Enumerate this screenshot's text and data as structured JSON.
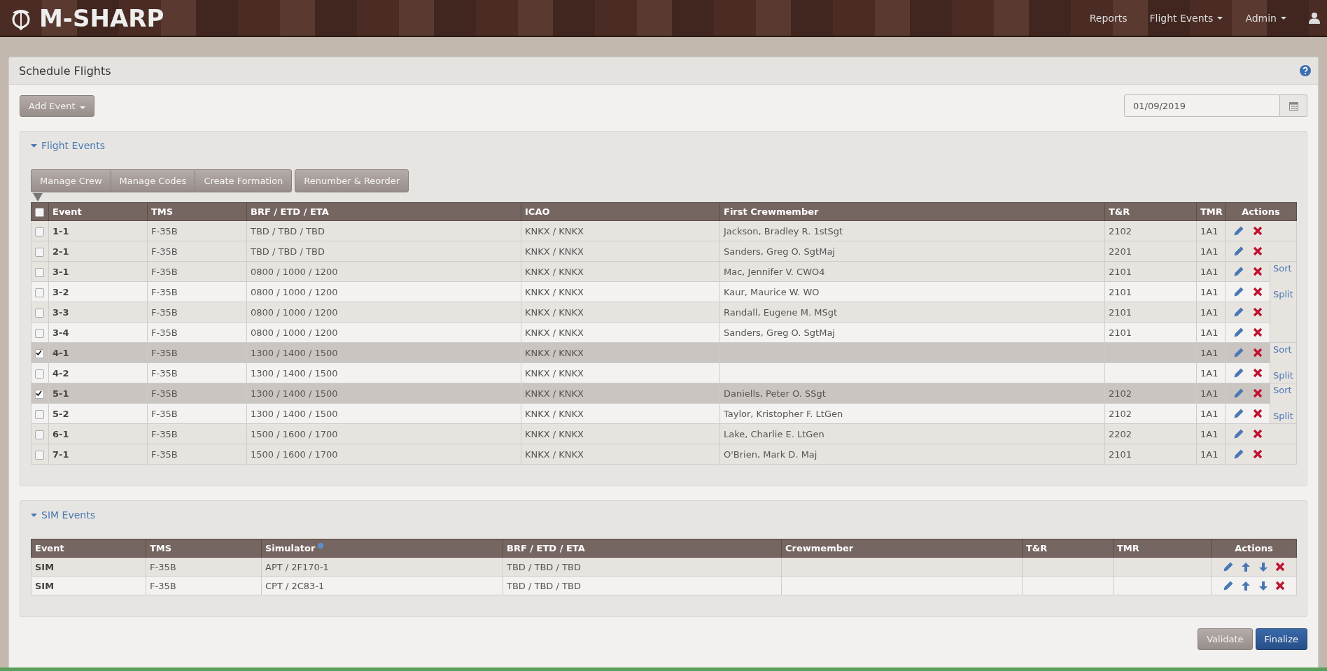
{
  "navbar": {
    "brand": "M-SHARP",
    "items": [
      {
        "label": "Reports",
        "dropdown": false
      },
      {
        "label": "Flight Events",
        "dropdown": true
      },
      {
        "label": "Admin",
        "dropdown": true
      }
    ]
  },
  "panel": {
    "title": "Schedule Flights",
    "add_button": "Add Event",
    "date": "01/09/2019"
  },
  "flight_events": {
    "title": "Flight Events",
    "expanded": true,
    "toolbar": [
      "Manage Crew",
      "Manage Codes",
      "Create Formation"
    ],
    "renumber_button": "Renumber & Reorder",
    "select_all": {
      "checked": false
    },
    "columns": [
      "Event",
      "TMS",
      "BRF / ETD / ETA",
      "ICAO",
      "First Crewmember",
      "T&R",
      "TMR",
      "Actions"
    ],
    "groups": [
      {
        "kind": "single",
        "rows": [
          {
            "event": "1-1",
            "tms": "F-35B",
            "times": "TBD / TBD / TBD",
            "icao": "KNKX / KNKX",
            "crew": "Jackson, Bradley R. 1stSgt",
            "tr": "2102",
            "tmr": "1A1",
            "checked": false
          }
        ]
      },
      {
        "kind": "single",
        "rows": [
          {
            "event": "2-1",
            "tms": "F-35B",
            "times": "TBD / TBD / TBD",
            "icao": "KNKX / KNKX",
            "crew": "Sanders, Greg O. SgtMaj",
            "tr": "2201",
            "tmr": "1A1",
            "checked": false
          }
        ]
      },
      {
        "kind": "formation",
        "sort": "Sort",
        "split": "Split",
        "rows": [
          {
            "event": "3-1",
            "tms": "F-35B",
            "times": "0800 / 1000 / 1200",
            "icao": "KNKX / KNKX",
            "crew": "Mac, Jennifer V. CWO4",
            "tr": "2101",
            "tmr": "1A1",
            "checked": false
          },
          {
            "event": "3-2",
            "tms": "F-35B",
            "times": "0800 / 1000 / 1200",
            "icao": "KNKX / KNKX",
            "crew": "Kaur, Maurice W. WO",
            "tr": "2101",
            "tmr": "1A1",
            "checked": false
          },
          {
            "event": "3-3",
            "tms": "F-35B",
            "times": "0800 / 1000 / 1200",
            "icao": "KNKX / KNKX",
            "crew": "Randall, Eugene M. MSgt",
            "tr": "2101",
            "tmr": "1A1",
            "checked": false
          },
          {
            "event": "3-4",
            "tms": "F-35B",
            "times": "0800 / 1000 / 1200",
            "icao": "KNKX / KNKX",
            "crew": "Sanders, Greg O. SgtMaj",
            "tr": "2101",
            "tmr": "1A1",
            "checked": false
          }
        ]
      },
      {
        "kind": "formation",
        "sort": "Sort",
        "split": "Split",
        "rows": [
          {
            "event": "4-1",
            "tms": "F-35B",
            "times": "1300 / 1400 / 1500",
            "icao": "KNKX / KNKX",
            "crew": "",
            "tr": "",
            "tmr": "1A1",
            "checked": true
          },
          {
            "event": "4-2",
            "tms": "F-35B",
            "times": "1300 / 1400 / 1500",
            "icao": "KNKX / KNKX",
            "crew": "",
            "tr": "",
            "tmr": "1A1",
            "checked": false
          }
        ]
      },
      {
        "kind": "formation",
        "sort": "Sort",
        "split": "Split",
        "rows": [
          {
            "event": "5-1",
            "tms": "F-35B",
            "times": "1300 / 1400 / 1500",
            "icao": "KNKX / KNKX",
            "crew": "Daniells, Peter O. SSgt",
            "tr": "2102",
            "tmr": "1A1",
            "checked": true
          },
          {
            "event": "5-2",
            "tms": "F-35B",
            "times": "1300 / 1400 / 1500",
            "icao": "KNKX / KNKX",
            "crew": "Taylor, Kristopher F. LtGen",
            "tr": "2102",
            "tmr": "1A1",
            "checked": false
          }
        ]
      },
      {
        "kind": "single",
        "rows": [
          {
            "event": "6-1",
            "tms": "F-35B",
            "times": "1500 / 1600 / 1700",
            "icao": "KNKX / KNKX",
            "crew": "Lake, Charlie E. LtGen",
            "tr": "2202",
            "tmr": "1A1",
            "checked": false
          }
        ]
      },
      {
        "kind": "single",
        "rows": [
          {
            "event": "7-1",
            "tms": "F-35B",
            "times": "1500 / 1600 / 1700",
            "icao": "KNKX / KNKX",
            "crew": "O'Brien, Mark D. Maj",
            "tr": "2101",
            "tmr": "1A1",
            "checked": false
          }
        ]
      }
    ]
  },
  "sim_events": {
    "title": "SIM Events",
    "expanded": true,
    "columns": [
      "Event",
      "TMS",
      "Simulator",
      "BRF / ETD / ETA",
      "Crewmember",
      "T&R",
      "TMR",
      "Actions"
    ],
    "rows": [
      {
        "event": "SIM",
        "tms": "F-35B",
        "simulator": "APT / 2F170-1",
        "times": "TBD / TBD / TBD"
      },
      {
        "event": "SIM",
        "tms": "F-35B",
        "simulator": "CPT / 2C83-1",
        "times": "TBD / TBD / TBD"
      }
    ]
  },
  "footer_buttons": [
    {
      "label": "Validate",
      "kind": "secondary"
    },
    {
      "label": "Finalize",
      "kind": "primary"
    }
  ]
}
